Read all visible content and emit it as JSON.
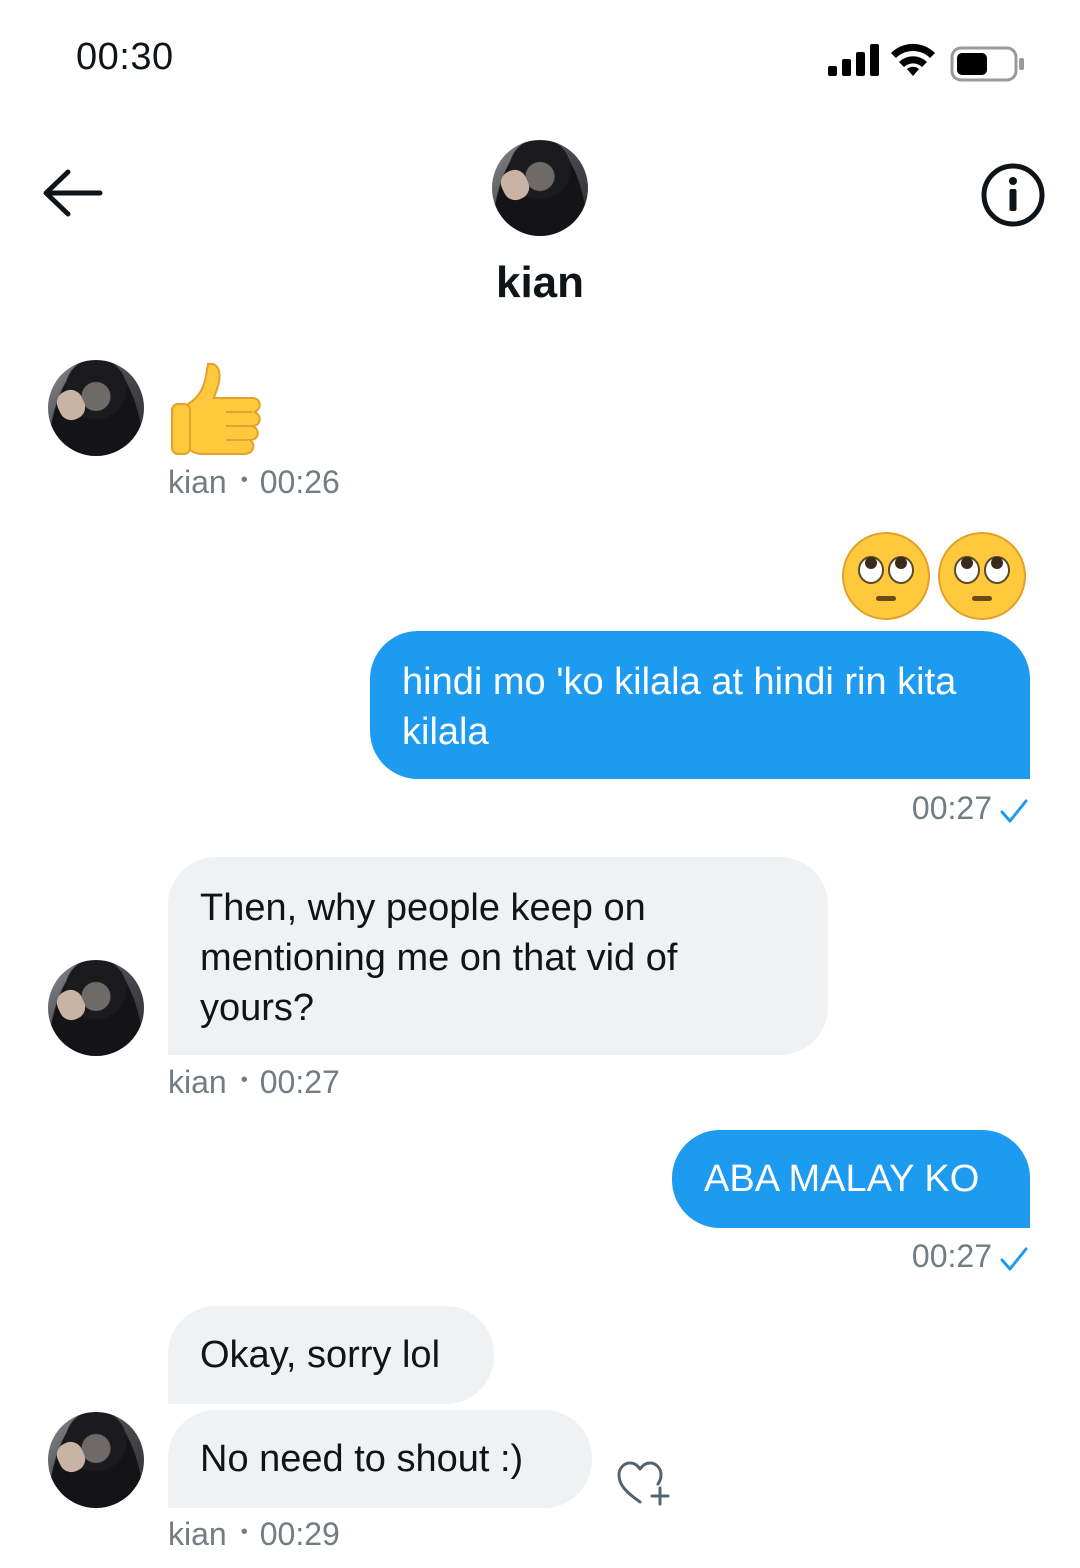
{
  "status_bar": {
    "time": "00:30"
  },
  "header": {
    "name": "kian"
  },
  "messages": [
    {
      "sender": "kian",
      "emoji": "thumbs-up",
      "meta_name": "kian",
      "meta_time": "00:26"
    },
    {
      "sender": "me",
      "emoji": "face-with-rolling-eyes x2"
    },
    {
      "sender": "me",
      "text": "hindi mo 'ko kilala at hindi rin kita kilala",
      "time": "00:27"
    },
    {
      "sender": "kian",
      "text": "Then, why people keep on mentioning me on that vid of yours?",
      "meta_name": "kian",
      "meta_time": "00:27"
    },
    {
      "sender": "me",
      "text": "ABA MALAY KO",
      "time": "00:27"
    },
    {
      "sender": "kian",
      "text": "Okay, sorry lol"
    },
    {
      "sender": "kian",
      "text": "No need to shout :)",
      "meta_name": "kian",
      "meta_time": "00:29"
    }
  ],
  "meta_dot": "•",
  "colors": {
    "outgoing": "#1d9bf0",
    "incoming": "#eff1f3",
    "meta": "#737b83"
  }
}
